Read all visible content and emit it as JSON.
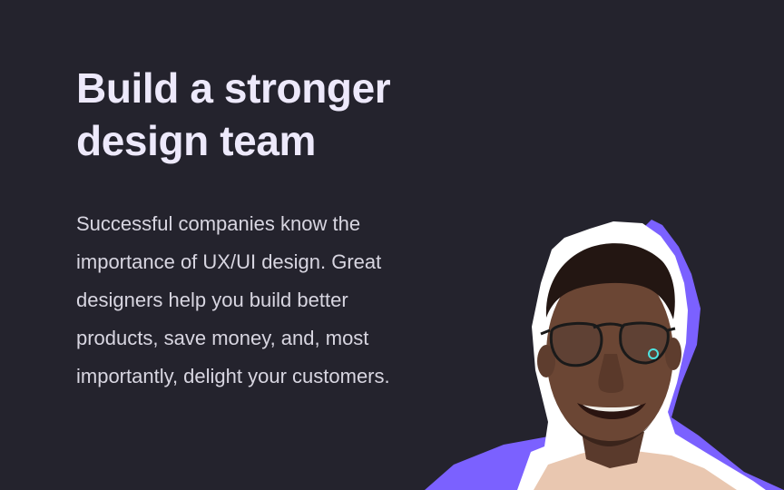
{
  "hero": {
    "headline": "Build a stronger\ndesign team",
    "body": "Successful companies know the\nimportance of UX/UI design. Great\ndesigners help you build better\nproducts, save money, and, most\nimportantly, delight your customers."
  },
  "colors": {
    "background": "#24232d",
    "headline": "#ede9fb",
    "body": "#d8d6e1",
    "accent": "#7b61ff",
    "cutout_border": "#ffffff"
  },
  "portrait": {
    "icon": "person-portrait-icon"
  }
}
